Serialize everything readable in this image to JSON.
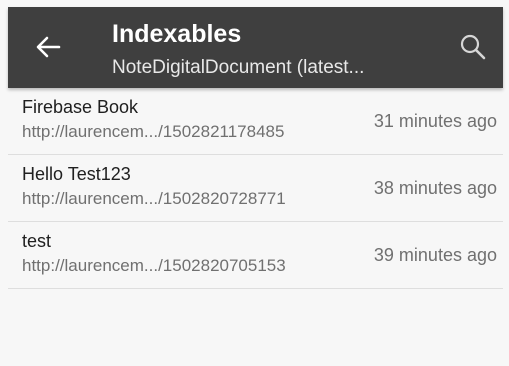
{
  "toolbar": {
    "title": "Indexables",
    "subtitle": "NoteDigitalDocument (latest...",
    "back_icon": "arrow-back-icon",
    "search_icon": "search-icon"
  },
  "items": [
    {
      "title": "Firebase Book",
      "url": "http://laurencem.../1502821178485",
      "time": "31 minutes ago"
    },
    {
      "title": "Hello Test123",
      "url": "http://laurencem.../1502820728771",
      "time": "38 minutes ago"
    },
    {
      "title": "test",
      "url": "http://laurencem.../1502820705153",
      "time": "39 minutes ago"
    }
  ],
  "colors": {
    "toolbar_background": "#3f3f3f",
    "screen_background": "#f7f7f7"
  }
}
